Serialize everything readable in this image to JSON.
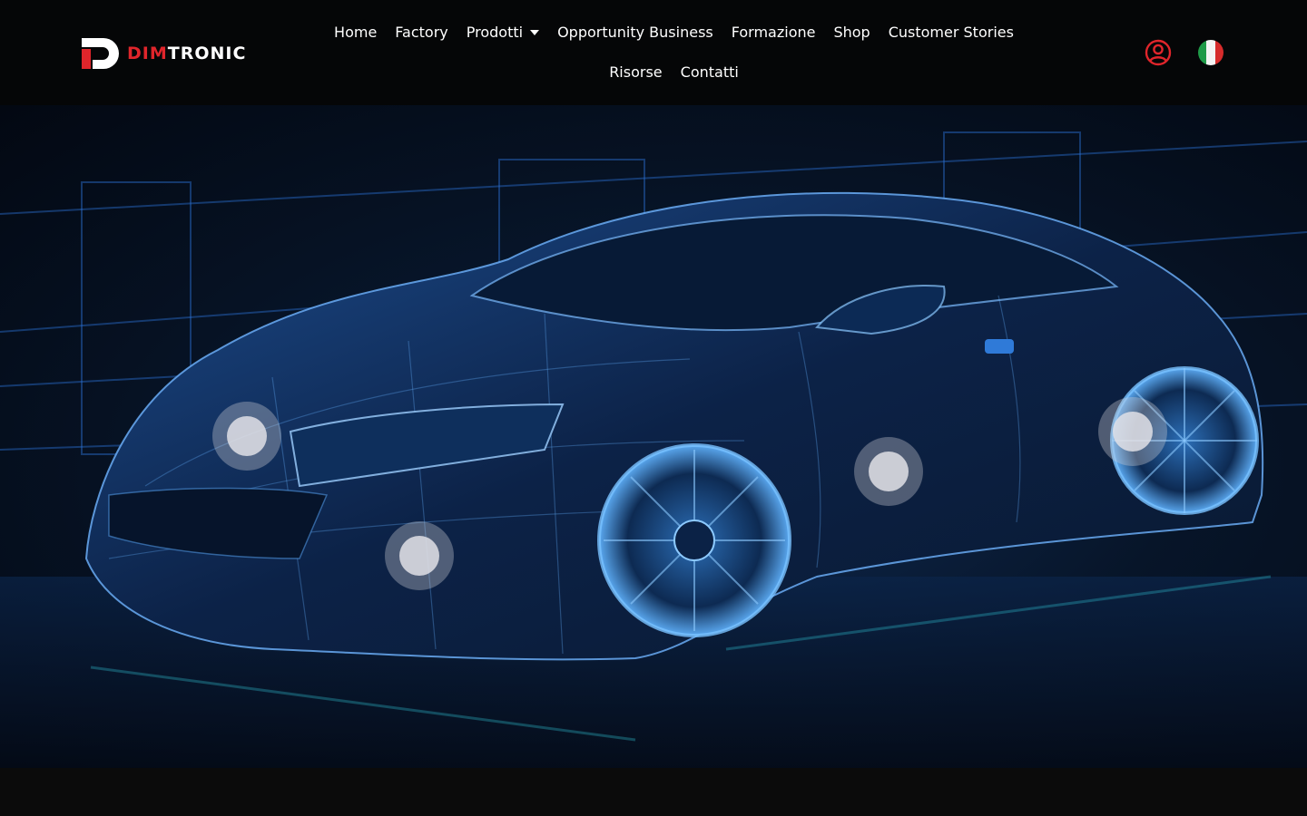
{
  "brand": {
    "logo_part1": "DIM",
    "logo_part2": "TRONIC",
    "accent_color": "#e0252b"
  },
  "nav": {
    "items": [
      {
        "label": "Home",
        "name": "nav-home"
      },
      {
        "label": "Factory",
        "name": "nav-factory"
      },
      {
        "label": "Prodotti",
        "name": "nav-prodotti",
        "dropdown": true
      },
      {
        "label": "Opportunity Business",
        "name": "nav-opportunity-business"
      },
      {
        "label": "Formazione",
        "name": "nav-formazione"
      },
      {
        "label": "Shop",
        "name": "nav-shop"
      },
      {
        "label": "Customer Stories",
        "name": "nav-customer-stories"
      },
      {
        "label": "Risorse",
        "name": "nav-risorse"
      },
      {
        "label": "Contatti",
        "name": "nav-contatti"
      }
    ]
  },
  "header_icons": {
    "account": "user-circle-icon",
    "language": "italy-flag-icon",
    "account_color": "#e0252b"
  },
  "hero": {
    "image": "wireframe-sports-car",
    "hotspots": [
      "hotspot-front-light",
      "hotspot-bumper",
      "hotspot-door",
      "hotspot-rear-wheel"
    ]
  }
}
